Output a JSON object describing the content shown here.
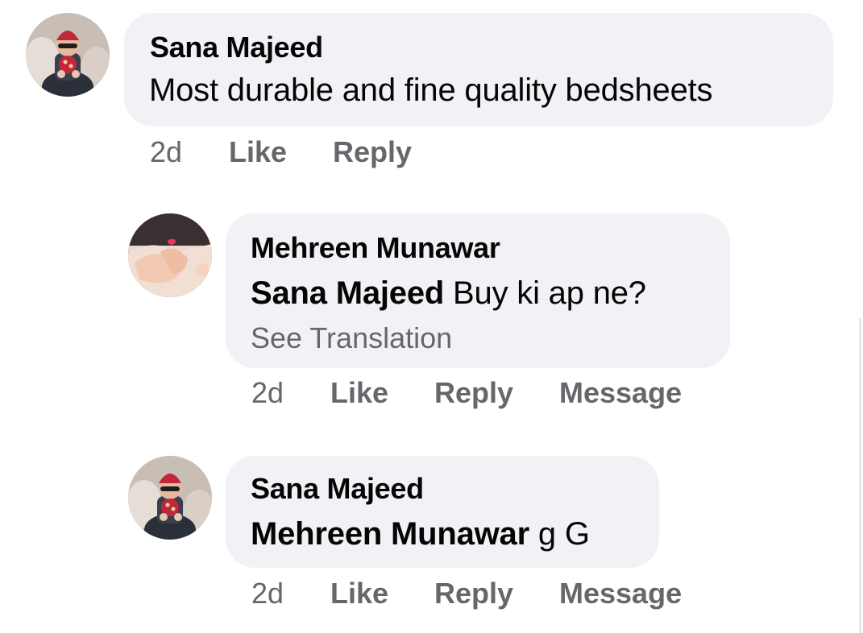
{
  "comments": [
    {
      "author": "Sana Majeed",
      "mention": "",
      "text": "Most durable and fine quality bedsheets",
      "time": "2d",
      "like_label": "Like",
      "reply_label": "Reply",
      "avatar_icon": "profile-photo-child-red-cap"
    },
    {
      "author": "Mehreen Munawar",
      "mention": "Sana Majeed",
      "text": "Buy ki ap ne?",
      "see_translation": "See Translation",
      "time": "2d",
      "like_label": "Like",
      "reply_label": "Reply",
      "message_label": "Message",
      "avatar_icon": "profile-photo-baby-hands-heart"
    },
    {
      "author": "Sana Majeed",
      "mention": "Mehreen Munawar",
      "text": "g G",
      "time": "2d",
      "like_label": "Like",
      "reply_label": "Reply",
      "message_label": "Message",
      "avatar_icon": "profile-photo-child-red-cap"
    }
  ],
  "colors": {
    "bubble": "#f0f2f5",
    "text": "#050505",
    "secondary": "#65676b"
  }
}
